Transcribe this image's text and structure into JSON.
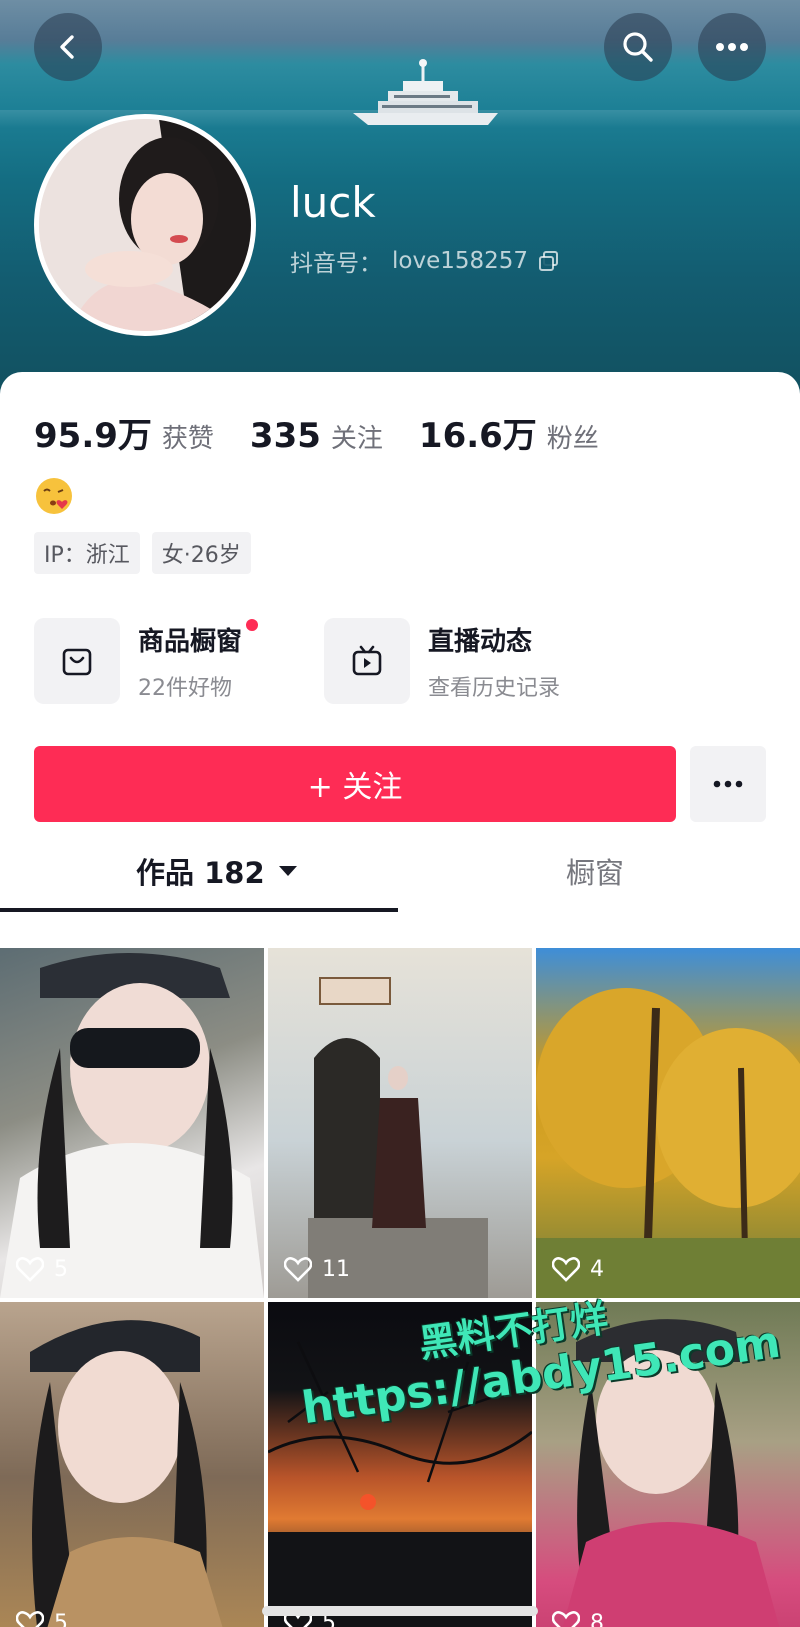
{
  "profile": {
    "nickname": "luck",
    "uid_label": "抖音号：",
    "uid": "love158257"
  },
  "stats": [
    {
      "value": "95.9万",
      "label": "获赞"
    },
    {
      "value": "335",
      "label": "关注"
    },
    {
      "value": "16.6万",
      "label": "粉丝"
    }
  ],
  "bio_emoji": "😘",
  "tags": [
    "IP：浙江",
    "女·26岁"
  ],
  "shortcuts": {
    "shop": {
      "title": "商品橱窗",
      "subtitle": "22件好物",
      "icon": "shopping-bag-icon"
    },
    "live": {
      "title": "直播动态",
      "subtitle": "查看历史记录",
      "icon": "tv-play-icon"
    }
  },
  "follow_button": "+ 关注",
  "tabs": {
    "works": "作品 182",
    "window": "橱窗"
  },
  "videos": [
    {
      "likes": "5"
    },
    {
      "likes": "11"
    },
    {
      "likes": "4"
    },
    {
      "likes": "5"
    },
    {
      "likes": "5"
    },
    {
      "likes": "8"
    }
  ],
  "watermark": {
    "line1": "黑料不打烊",
    "line2": "https://abdy15.com"
  },
  "colors": {
    "accent": "#fe2c55",
    "watermark": "#3fe7b7"
  }
}
